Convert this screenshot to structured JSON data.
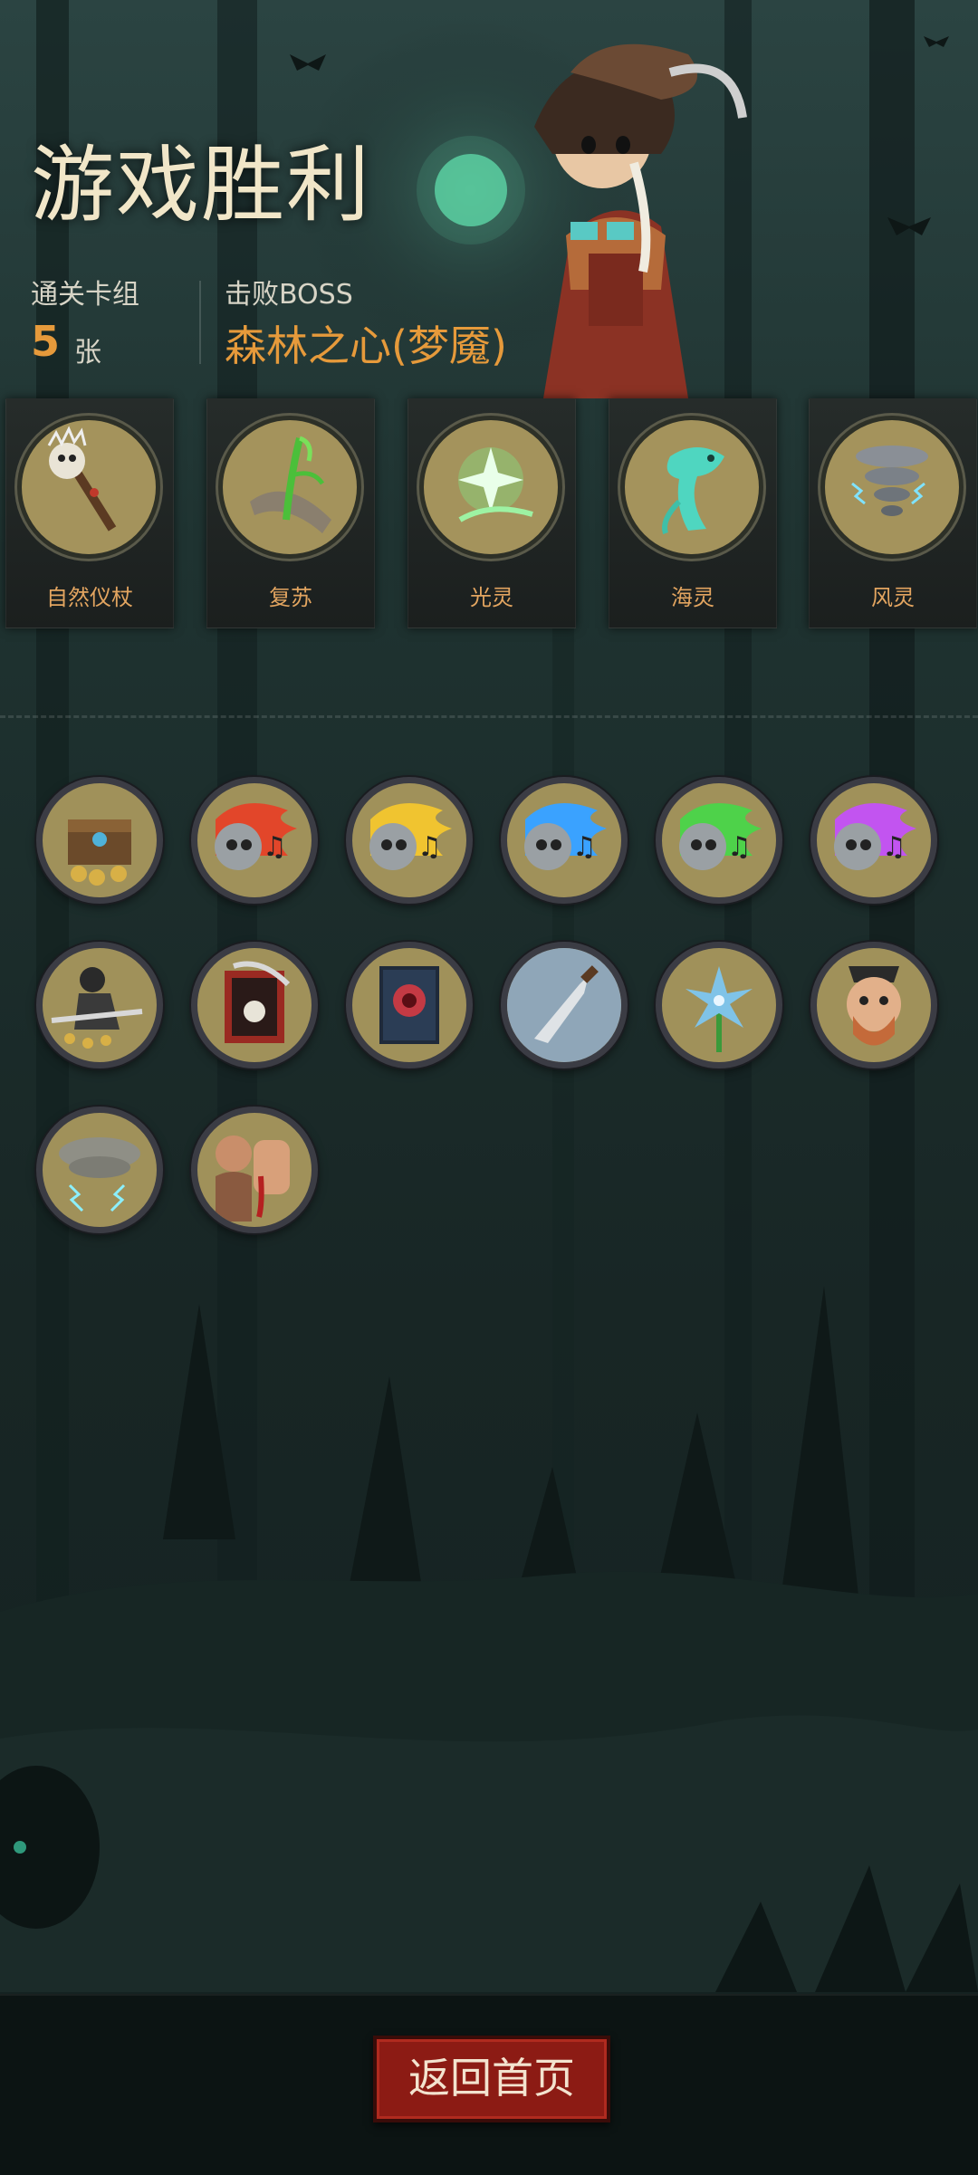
{
  "title": "游戏胜利",
  "stats": {
    "deck_label": "通关卡组",
    "deck_count": "5",
    "deck_unit": "张",
    "boss_label": "击败BOSS",
    "boss_name": "森林之心(梦魇)"
  },
  "cards": [
    {
      "label": "自然仪杖",
      "icon": "staff-icon"
    },
    {
      "label": "复苏",
      "icon": "revive-icon"
    },
    {
      "label": "光灵",
      "icon": "light-spirit-icon"
    },
    {
      "label": "海灵",
      "icon": "sea-spirit-icon"
    },
    {
      "label": "风灵",
      "icon": "wind-spirit-icon"
    }
  ],
  "relics": [
    {
      "icon": "treasure-chest-icon",
      "color": "#c9a23a"
    },
    {
      "icon": "fire-skull-music-icon",
      "color": "#e2462a"
    },
    {
      "icon": "yellow-fire-skull-music-icon",
      "color": "#f0c430"
    },
    {
      "icon": "blue-fire-skull-music-icon",
      "color": "#3aa2ff"
    },
    {
      "icon": "green-fire-skull-music-icon",
      "color": "#4ed24a"
    },
    {
      "icon": "purple-fire-skull-music-icon",
      "color": "#c254f0"
    },
    {
      "icon": "ninja-gold-icon",
      "color": "#d8b046"
    },
    {
      "icon": "skull-banner-icon",
      "color": "#9a2a22"
    },
    {
      "icon": "red-book-icon",
      "color": "#c43a44"
    },
    {
      "icon": "knife-icon",
      "color": "#8fa6b8"
    },
    {
      "icon": "blue-flower-icon",
      "color": "#7fc3e8"
    },
    {
      "icon": "pirate-face-icon",
      "color": "#c46a3a"
    },
    {
      "icon": "storm-whirl-icon",
      "color": "#8bbcc2"
    },
    {
      "icon": "bloody-brawler-icon",
      "color": "#b52020"
    }
  ],
  "buttons": {
    "home": "返回首页"
  }
}
